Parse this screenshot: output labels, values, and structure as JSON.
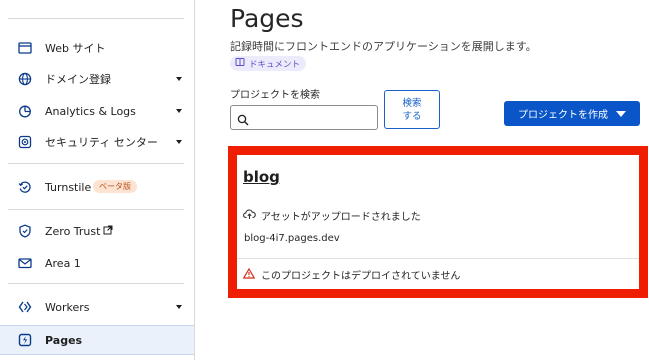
{
  "sidebar": {
    "items": [
      {
        "label": "Web サイト",
        "icon": "browser-icon",
        "has_caret": false
      },
      {
        "label": "ドメイン登録",
        "icon": "globe-icon",
        "has_caret": true
      },
      {
        "label": "Analytics & Logs",
        "icon": "pie-chart-icon",
        "has_caret": true
      },
      {
        "label": "セキュリティ センター",
        "icon": "security-center-icon",
        "has_caret": true
      },
      {
        "label": "Turnstile",
        "icon": "turnstile-icon",
        "has_caret": false,
        "badge": "ベータ版"
      },
      {
        "label": "Zero Trust",
        "icon": "zero-trust-icon",
        "has_caret": false,
        "external": true
      },
      {
        "label": "Area 1",
        "icon": "mail-icon",
        "has_caret": false
      },
      {
        "label": "Workers",
        "icon": "workers-icon",
        "has_caret": true
      },
      {
        "label": "Pages",
        "icon": "pages-icon",
        "has_caret": false,
        "active": true
      }
    ]
  },
  "main": {
    "title": "Pages",
    "description": "記録時間にフロントエンドのアプリケーションを展開します。",
    "doc_tag": "ドキュメント",
    "search": {
      "label": "プロジェクトを検索",
      "value": "",
      "button": "検索\nする"
    },
    "create_button": "プロジェクトを作成"
  },
  "project": {
    "name": "blog",
    "status": "アセットがアップロードされました",
    "url": "blog-4i7.pages.dev",
    "warning": "このプロジェクトはデプロイされていません"
  },
  "colors": {
    "accent": "#0a55c8",
    "highlight": "#f01e00",
    "warning": "#d32f1e",
    "badge_bg": "#fde3d2",
    "tag_bg": "#ecebfb"
  }
}
